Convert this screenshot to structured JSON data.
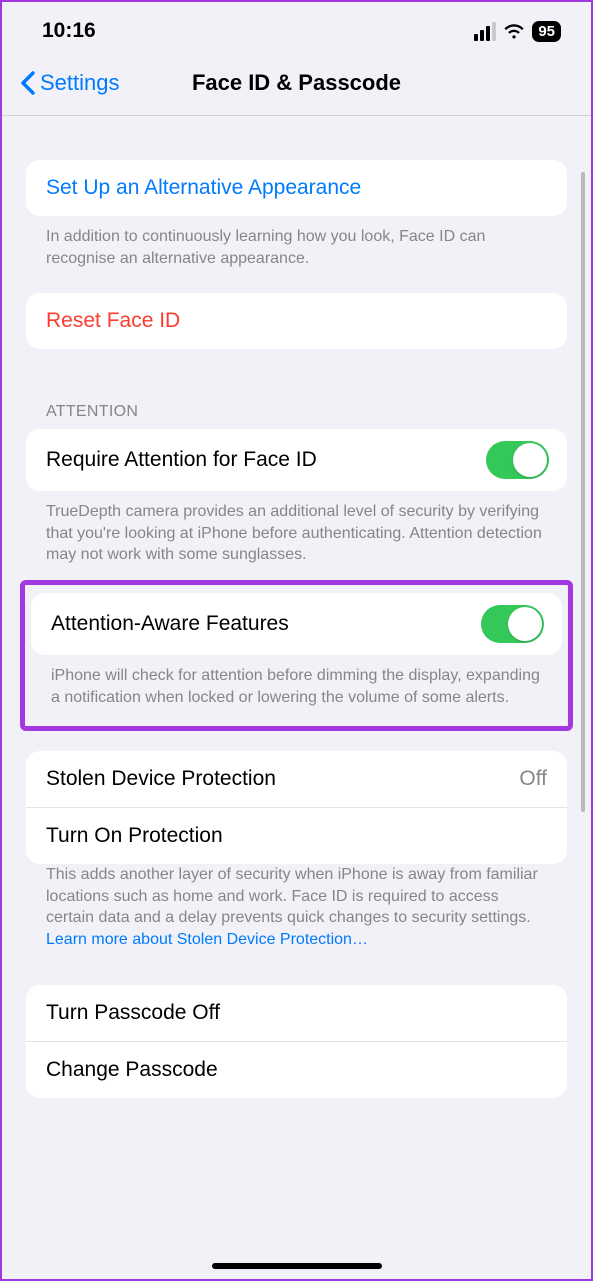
{
  "status": {
    "time": "10:16",
    "battery": "95"
  },
  "nav": {
    "back": "Settings",
    "title": "Face ID & Passcode"
  },
  "alt_appearance": {
    "label": "Set Up an Alternative Appearance",
    "footer": "In addition to continuously learning how you look, Face ID can recognise an alternative appearance."
  },
  "reset": {
    "label": "Reset Face ID"
  },
  "attention": {
    "header": "ATTENTION",
    "require": {
      "label": "Require Attention for Face ID",
      "footer": "TrueDepth camera provides an additional level of security by verifying that you're looking at iPhone before authenticating. Attention detection may not work with some sunglasses."
    },
    "aware": {
      "label": "Attention-Aware Features",
      "footer": "iPhone will check for attention before dimming the display, expanding a notification when locked or lowering the volume of some alerts."
    }
  },
  "stolen": {
    "label": "Stolen Device Protection",
    "value": "Off",
    "turn_on": "Turn On Protection",
    "footer_text": "This adds another layer of security when iPhone is away from familiar locations such as home and work. Face ID is required to access certain data and a delay prevents quick changes to security settings. ",
    "footer_link": "Learn more about Stolen Device Protection…"
  },
  "passcode": {
    "turn_off": "Turn Passcode Off",
    "change": "Change Passcode"
  }
}
